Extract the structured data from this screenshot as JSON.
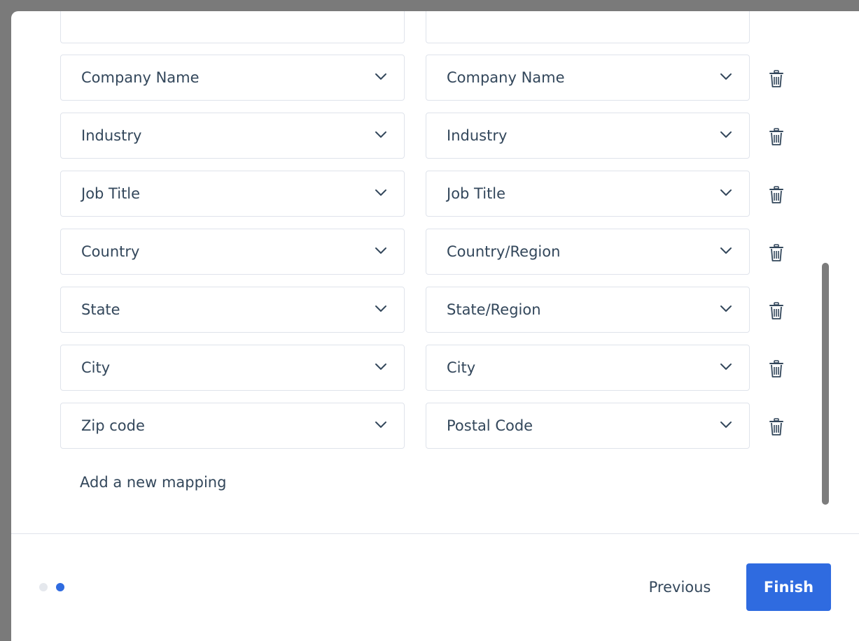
{
  "colors": {
    "accent": "#2f6be0",
    "text": "#33475b",
    "border": "#dfe3eb",
    "dot_inactive": "#e5e8ed",
    "dot_active": "#2f6be0"
  },
  "mappings": [
    {
      "source": "Company Name",
      "target": "Company Name"
    },
    {
      "source": "Industry",
      "target": "Industry"
    },
    {
      "source": "Job Title",
      "target": "Job Title"
    },
    {
      "source": "Country",
      "target": "Country/Region"
    },
    {
      "source": "State",
      "target": "State/Region"
    },
    {
      "source": "City",
      "target": "City"
    },
    {
      "source": "Zip code",
      "target": "Postal Code"
    }
  ],
  "add_mapping_label": "Add a new mapping",
  "footer": {
    "previous_label": "Previous",
    "finish_label": "Finish",
    "steps_total": 2,
    "current_step": 2
  },
  "icons": {
    "dropdown": "chevron-down-icon",
    "delete": "trash-icon"
  }
}
